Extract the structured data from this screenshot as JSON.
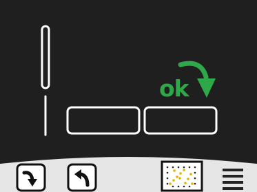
{
  "app": {
    "theme": {
      "display_bg": "#1f1f1f",
      "stroke": "#ffffff",
      "accent_green": "#2fa84a",
      "toolbar_bg": "#e6e6e6",
      "chart_icon_dots": "#e8b100"
    }
  },
  "display": {
    "confirm_label": "ok",
    "confirm_arrow_icon": "curved-down-arrow"
  },
  "toolbar": {
    "buttons": [
      {
        "icon": "redo-arrow-icon"
      },
      {
        "icon": "undo-arrow-icon"
      },
      {
        "icon": "chart-grid-icon"
      },
      {
        "icon": "menu-icon"
      }
    ]
  }
}
